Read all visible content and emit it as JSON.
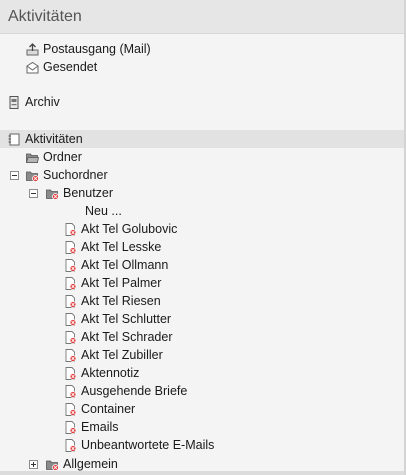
{
  "header": {
    "title": "Aktivitäten"
  },
  "top_items": [
    {
      "label": "Postausgang (Mail)",
      "icon": "outbox-icon"
    },
    {
      "label": "Gesendet",
      "icon": "sent-envelope-icon"
    }
  ],
  "archive": {
    "label": "Archiv",
    "icon": "archive-icon"
  },
  "tree": {
    "root": {
      "label": "Aktivitäten",
      "icon": "activities-icon"
    },
    "ordner": {
      "label": "Ordner",
      "icon": "folder-icon"
    },
    "suchordner": {
      "label": "Suchordner",
      "icon": "search-folder-icon"
    },
    "benutzer": {
      "label": "Benutzer",
      "icon": "search-folder-icon"
    },
    "neu": {
      "label": "Neu ..."
    },
    "items": [
      "Akt Tel Golubovic",
      "Akt Tel Lesske",
      "Akt Tel Ollmann",
      "Akt Tel Palmer",
      "Akt Tel Riesen",
      "Akt Tel Schlutter",
      "Akt Tel Schrader",
      "Akt Tel Zubiller",
      "Aktennotiz",
      "Ausgehende Briefe",
      "Container",
      "Emails",
      "Unbeantwortete E-Mails"
    ],
    "allgemein": {
      "label": "Allgemein",
      "icon": "search-folder-icon"
    }
  }
}
